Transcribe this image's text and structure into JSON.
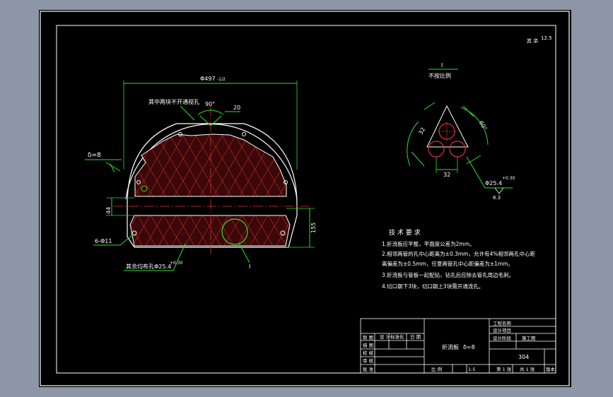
{
  "drawing": {
    "corner_mark": "其 余",
    "corner_roughness": "12.5",
    "main_width_dim": "Φ497",
    "main_width_suffix": "-1/2",
    "note_no_hole": "其中两块不开通视孔",
    "angle_top": "90°",
    "dim_20": "20",
    "delta_label": "δ=8",
    "dim_44": "44",
    "dim_155": "155",
    "hole_small_label": "6-Φ11",
    "tube_hole_label": "其余均布孔Φ25.4",
    "tube_hole_tol": "+0.30",
    "leader_1": "I",
    "detail_label": "I",
    "detail_scale": "不按比例",
    "detail_angle": "60°",
    "detail_dim_32a": "32",
    "detail_dim_32b": "32",
    "detail_hole": "Φ25.4",
    "detail_hole_tol": "+0.30",
    "detail_hole_rough": "6.3"
  },
  "requirements": {
    "title": "技 术 要 求",
    "items": [
      "1.折流板应平整，平面度公差为2mm。",
      "2.相邻两管的孔中心距离为±0.3mm，允许有4%相邻两孔中心距",
      "   离偏差为±0.5mm，任意两管孔中心距偏差为±1mm。",
      "3.折流板与管板一起配钻，钻孔后应除去管孔周边毛刺。",
      "4.切口朝下3块，切口朝上3块需开通流孔。"
    ]
  },
  "title_block": {
    "c_shejii": "设 计",
    "c_biaozhun": "标准化",
    "c_riqi": "日 期",
    "r1": "工程名称",
    "r2": "设计项目",
    "r3": "设计阶段",
    "r3b": "施工图",
    "part_name": "折流板",
    "part_delta": "δ=8",
    "material": "304",
    "r_jiaohe": "校 核",
    "r_shenhe": "审 核",
    "r_pizhun": "批 准",
    "scale_label": "比 例",
    "scale_value": "1:5",
    "sheet_num": "第 1 张",
    "sheet_total": "共 1 张",
    "rev": "版本",
    "label_zhitu": "制 图",
    "label_miaotu": "描 图"
  }
}
